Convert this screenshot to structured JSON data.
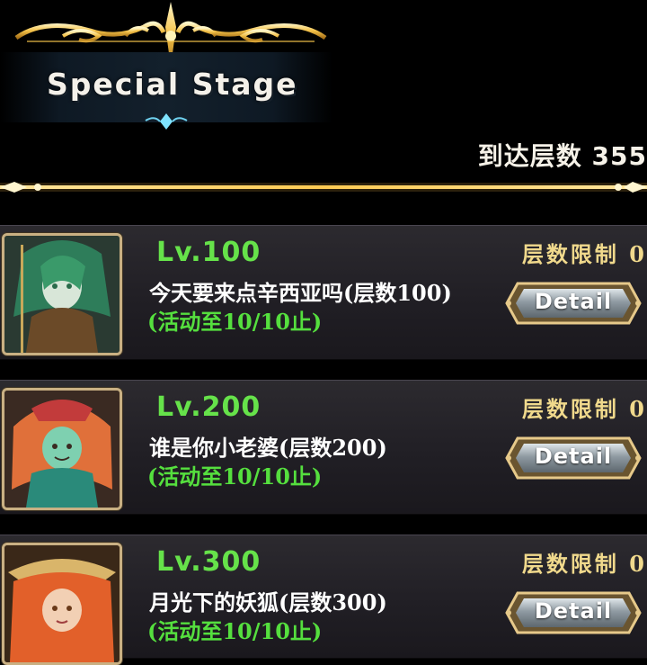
{
  "header": {
    "title": "Special Stage",
    "reached_label": "到达层数",
    "reached_value": "355"
  },
  "stages": [
    {
      "level": "Lv.100",
      "name": "今天要来点辛西亚吗(层数100)",
      "period": "(活动至10/10止)",
      "limit": "层数限制 0",
      "detail_label": "Detail",
      "portrait": "green-haired-warrior-portrait"
    },
    {
      "level": "Lv.200",
      "name": "谁是你小老婆(层数200)",
      "period": "(活动至10/10止)",
      "limit": "层数限制 0",
      "detail_label": "Detail",
      "portrait": "red-haired-witch-portrait"
    },
    {
      "level": "Lv.300",
      "name": "月光下的妖狐(层数300)",
      "period": "(活动至10/10止)",
      "limit": "层数限制 0",
      "detail_label": "Detail",
      "portrait": "fox-girl-portrait"
    }
  ],
  "colors": {
    "level_green": "#66e24a",
    "period_green": "#55df3e",
    "limit_gold": "#f0d98c",
    "accent_gold": "#f5c24a"
  }
}
